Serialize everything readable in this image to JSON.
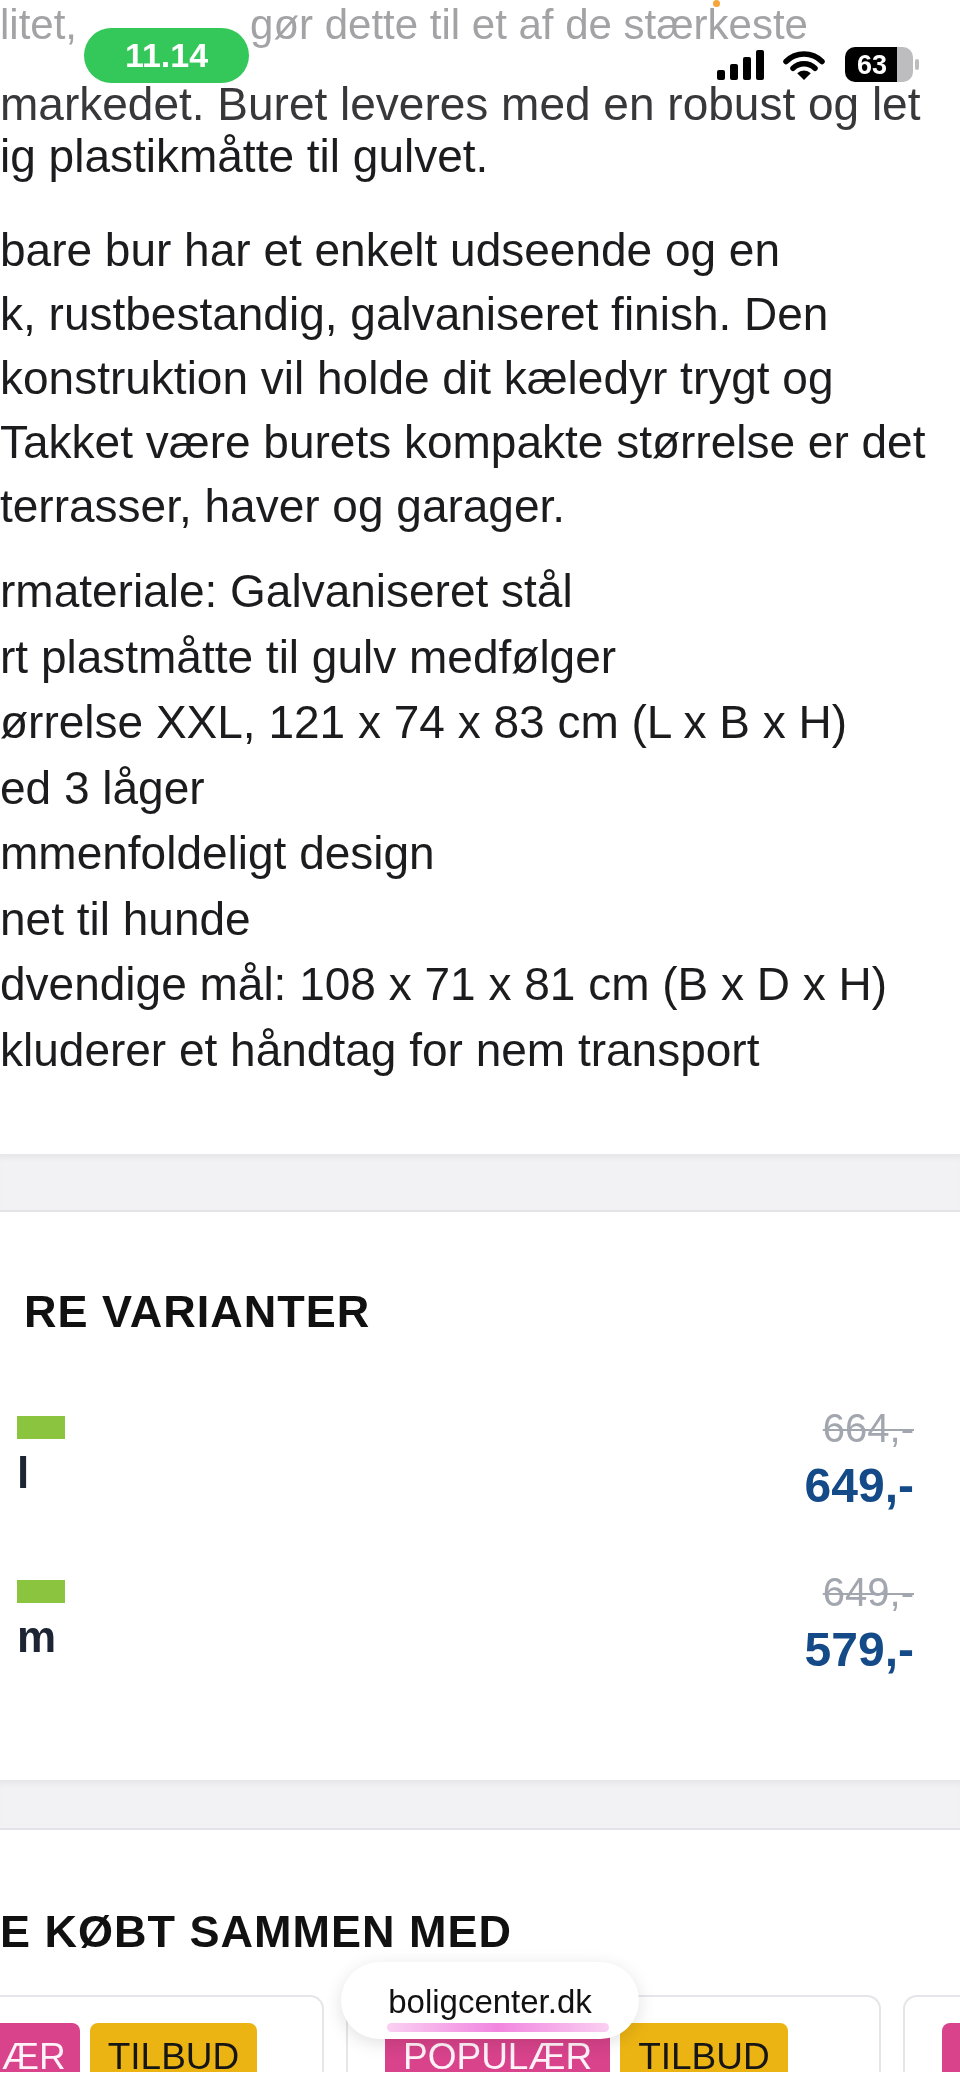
{
  "status_bar": {
    "time": "11.14",
    "battery": "63"
  },
  "description": {
    "top_line": [
      "litet,",
      "gør dette til et af de stærkeste"
    ],
    "paragraphs": [
      [
        "markedet. Buret leveres med en robust og let",
        "ig plastikmåtte til gulvet."
      ],
      [
        "bare bur har et enkelt udseende og en",
        "k, rustbestandig, galvaniseret finish. Den",
        "konstruktion vil holde dit kæledyr trygt og",
        "Takket være burets kompakte størrelse er det",
        "terrasser, haver og garager."
      ]
    ],
    "features": [
      "rmateriale: Galvaniseret stål",
      "rt plastmåtte til gulv medfølger",
      "ørrelse XXL, 121 x 74 x 83 cm (L x B x H)",
      "ed 3 låger",
      "mmenfoldeligt design",
      "net til hunde",
      "dvendige mål: 108 x 71 x 81 cm (B x D x H)",
      "kluderer et håndtag for nem transport"
    ]
  },
  "variants": {
    "title": "RE VARIANTER",
    "items": [
      {
        "name": "l",
        "old_price": "664,-",
        "price": "649,-"
      },
      {
        "name": "m",
        "old_price": "649,-",
        "price": "579,-"
      }
    ]
  },
  "bought_together": {
    "title": "E KØBT SAMMEN MED",
    "cards": [
      {
        "tags": [
          {
            "label": "ÆR",
            "color": "#d8438b"
          },
          {
            "label": "TILBUD",
            "color": "#ecb413"
          }
        ]
      },
      {
        "tags": [
          {
            "label": "POPULÆR",
            "color": "#d8438b"
          },
          {
            "label": "TILBUD",
            "color": "#ecb413"
          }
        ]
      },
      {
        "tags": [
          {
            "color": "#d8438b"
          }
        ]
      }
    ]
  },
  "browser_bar": {
    "url": "boligcenter.dk"
  }
}
